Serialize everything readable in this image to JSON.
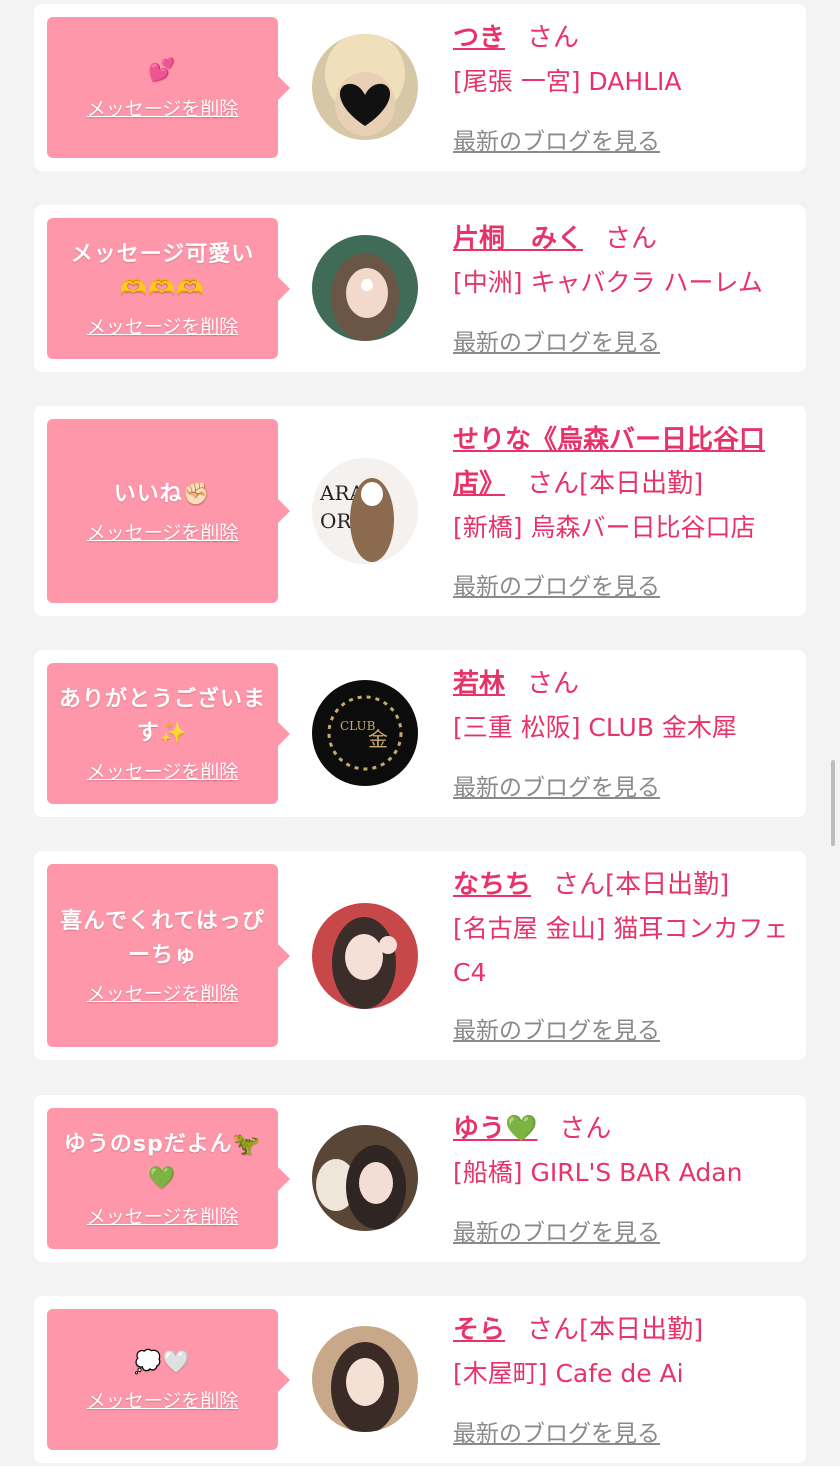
{
  "delete_label": "メッセージを削除",
  "blog_label": "最新のブログを見る",
  "honorific": "さん",
  "cards": [
    {
      "message": "💕",
      "name": "つき",
      "status": "",
      "shop": "[尾張 一宮] DAHLIA",
      "avatar_icon": "blonde-hair-heart-sticker-photo"
    },
    {
      "message": "メッセージ可愛い🫶🫶🫶",
      "name": "片桐　みく",
      "status": "",
      "shop": "[中洲] キャバクラ ハーレム",
      "avatar_icon": "woman-selfie-photo"
    },
    {
      "message": "いいね✊🏻",
      "name": "せりな《烏森バー日比谷口店》",
      "status": "[本日出勤]",
      "shop": "[新橋] 烏森バー日比谷口店",
      "avatar_icon": "woman-bar-logo-photo"
    },
    {
      "message": "ありがとうございます✨",
      "name": "若林",
      "status": "",
      "shop": "[三重 松阪] CLUB 金木犀",
      "avatar_icon": "club-logo-photo"
    },
    {
      "message": "喜んでくれてはっぴーちゅ",
      "name": "なちち",
      "status": "[本日出勤]",
      "shop": "[名古屋 金山] 猫耳コンカフェ C4",
      "avatar_icon": "woman-ok-sign-photo"
    },
    {
      "message": "ゆうのspだよん🦖💚",
      "name": "ゆう💚",
      "status": "",
      "shop": "[船橋] GIRL'S BAR Adan",
      "avatar_icon": "woman-plush-toy-photo"
    },
    {
      "message": "💭🤍",
      "name": "そら",
      "status": "[本日出勤]",
      "shop": "[木屋町] Cafe de Ai",
      "avatar_icon": "woman-portrait-photo"
    }
  ]
}
